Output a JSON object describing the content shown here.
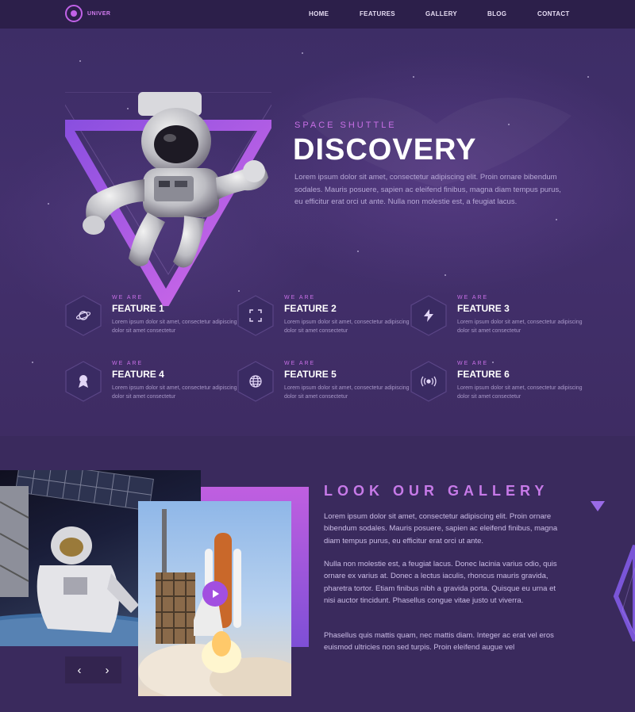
{
  "nav": {
    "logo_text": "UNIVER",
    "links": [
      {
        "label": "HOME"
      },
      {
        "label": "FEATURES"
      },
      {
        "label": "GALLERY"
      },
      {
        "label": "BLOG"
      },
      {
        "label": "CONTACT"
      }
    ]
  },
  "hero": {
    "subtitle": "SPACE SHUTTLE",
    "title": "DISCOVERY",
    "text": "Lorem ipsum dolor sit amet, consectetur adipiscing elit. Proin ornare bibendum sodales. Mauris posuere, sapien ac eleifend finibus, magna diam tempus purus, eu efficitur erat orci ut ante. Nulla non molestie est, a feugiat lacus."
  },
  "features": [
    {
      "eyebrow": "WE ARE",
      "title": "FEATURE 1",
      "text": "Lorem ipsum dolor sit amet, consectetur adipiscing dolor sit amet consectetur",
      "icon": "planet-icon"
    },
    {
      "eyebrow": "WE ARE",
      "title": "FEATURE 2",
      "text": "Lorem ipsum dolor sit amet, consectetur adipiscing dolor sit amet consectetur",
      "icon": "focus-frame-icon"
    },
    {
      "eyebrow": "WE ARE",
      "title": "FEATURE 3",
      "text": "Lorem ipsum dolor sit amet, consectetur adipiscing dolor sit amet consectetur",
      "icon": "lightning-icon"
    },
    {
      "eyebrow": "WE ARE",
      "title": "FEATURE 4",
      "text": "Lorem ipsum dolor sit amet, consectetur adipiscing dolor sit amet consectetur",
      "icon": "award-icon"
    },
    {
      "eyebrow": "WE ARE",
      "title": "FEATURE 5",
      "text": "Lorem ipsum dolor sit amet, consectetur adipiscing dolor sit amet consectetur",
      "icon": "globe-icon"
    },
    {
      "eyebrow": "WE ARE",
      "title": "FEATURE 6",
      "text": "Lorem ipsum dolor sit amet, consectetur adipiscing dolor sit amet consectetur",
      "icon": "broadcast-icon"
    }
  ],
  "gallery": {
    "title": "LOOK OUR GALLERY",
    "para1": "Lorem ipsum dolor sit amet, consectetur adipiscing elit. Proin ornare bibendum sodales. Mauris posuere, sapien ac eleifend finibus, magna diam tempus purus, eu efficitur erat orci ut ante.",
    "para2": "Nulla non molestie est, a feugiat lacus. Donec lacinia varius odio, quis ornare ex varius at. Donec a lectus iaculis, rhoncus mauris gravida, pharetra tortor. Etiam finibus nibh a gravida porta. Quisque eu urna et nisi auctor tincidunt. Phasellus congue vitae justo ut viverra.",
    "para3": "Phasellus quis mattis quam, nec mattis diam. Integer ac erat vel eros euismod ultricies non sed turpis. Proin eleifend augue vel",
    "prev_label": "‹",
    "next_label": "›"
  },
  "colors": {
    "accent": "#c86fe6",
    "background": "#3b2a5e",
    "nav": "#2c1f4a"
  }
}
